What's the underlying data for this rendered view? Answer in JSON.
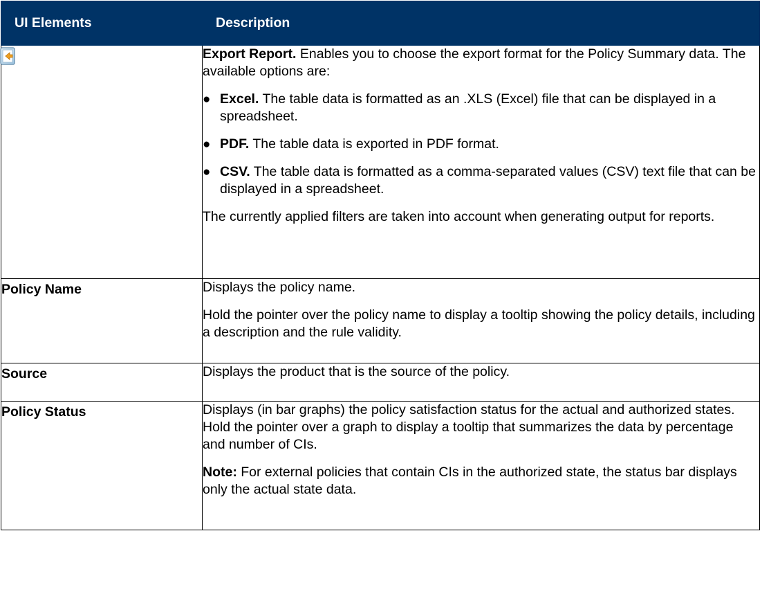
{
  "header": {
    "col1": "UI Elements",
    "col2": "Description"
  },
  "rows": [
    {
      "element_icon": "export-report-icon",
      "title": "Export Report.",
      "intro": " Enables you to choose the export format for the Policy Summary data. The available options are:",
      "options": [
        {
          "label": "Excel.",
          "text": " The table data is formatted as an .XLS (Excel) file that can be displayed in a spreadsheet."
        },
        {
          "label": "PDF.",
          "text": " The table data is exported in PDF format."
        },
        {
          "label": "CSV.",
          "text": " The table data is formatted as a comma-separated values (CSV) text file that can be displayed in a spreadsheet."
        }
      ],
      "footer": "The currently applied filters are taken into account when generating output for reports."
    },
    {
      "element": "Policy Name",
      "paragraphs": [
        "Displays the policy name.",
        "Hold the pointer over the policy name to display a tooltip showing the policy details, including a description and the rule validity."
      ]
    },
    {
      "element": "Source",
      "paragraphs": [
        "Displays the product that is the source of the policy."
      ]
    },
    {
      "element": "Policy Status",
      "paragraphs": [
        "Displays (in bar graphs) the policy satisfaction status for the actual and authorized states. Hold the pointer over a graph to display a tooltip that summarizes the data by percentage and number of CIs."
      ],
      "note_label": "Note:",
      "note_text": " For external policies that contain CIs in the authorized state, the status bar displays only the actual state data."
    }
  ],
  "colors": {
    "header_bg": "#003366",
    "header_text": "#ffffff",
    "border": "#000000"
  }
}
